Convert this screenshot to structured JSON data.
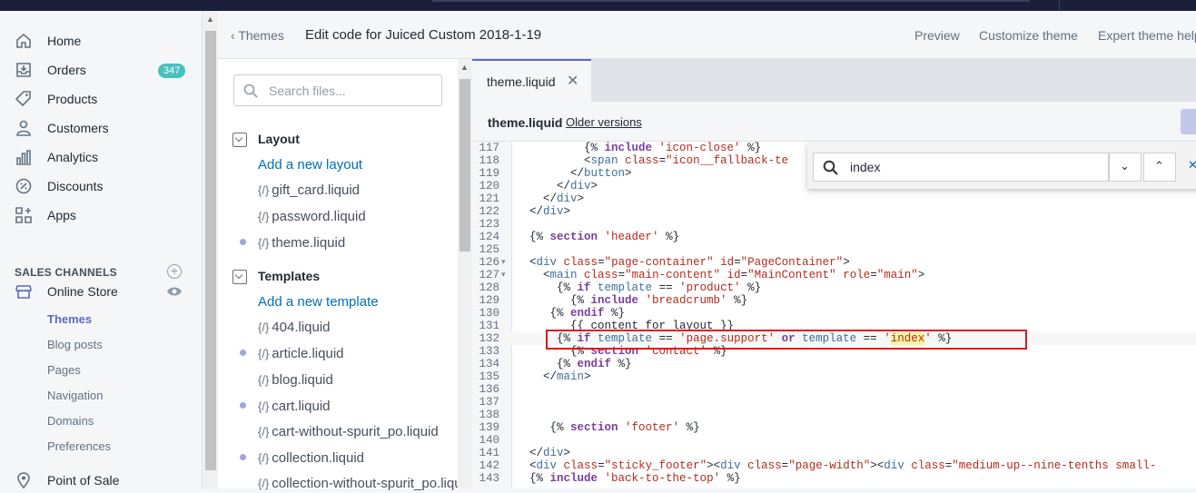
{
  "sidebar": {
    "items": [
      {
        "label": "Home",
        "icon": "home-icon"
      },
      {
        "label": "Orders",
        "icon": "orders-icon",
        "badge": "347"
      },
      {
        "label": "Products",
        "icon": "tag-icon"
      },
      {
        "label": "Customers",
        "icon": "person-icon"
      },
      {
        "label": "Analytics",
        "icon": "bar-chart-icon"
      },
      {
        "label": "Discounts",
        "icon": "discount-icon"
      },
      {
        "label": "Apps",
        "icon": "apps-icon"
      }
    ],
    "channels_heading": "SALES CHANNELS",
    "online_store": "Online Store",
    "sub_items": [
      "Themes",
      "Blog posts",
      "Pages",
      "Navigation",
      "Domains",
      "Preferences"
    ],
    "point_of_sale": "Point of Sale"
  },
  "header": {
    "back_label": "Themes",
    "title_prefix": "Edit code for",
    "theme_name": "Juiced Custom 2018-1-19",
    "actions": [
      "Preview",
      "Customize theme",
      "Expert theme help"
    ]
  },
  "files": {
    "search_placeholder": "Search files...",
    "layout_heading": "Layout",
    "add_layout": "Add a new layout",
    "layout_files": [
      "gift_card.liquid",
      "password.liquid",
      "theme.liquid"
    ],
    "templates_heading": "Templates",
    "add_template": "Add a new template",
    "template_files": [
      "404.liquid",
      "article.liquid",
      "blog.liquid",
      "cart.liquid",
      "cart-without-spurit_po.liquid",
      "collection.liquid",
      "collection-without-spurit_po.liquid"
    ]
  },
  "editor": {
    "tab_name": "theme.liquid",
    "file_name": "theme.liquid",
    "older_versions": "Older versions",
    "find_value": "index",
    "line_numbers": [
      "117",
      "118",
      "119",
      "120",
      "121",
      "122",
      "123",
      "124",
      "125",
      "126",
      "127",
      "128",
      "129",
      "130",
      "131",
      "132",
      "133",
      "134",
      "135",
      "136",
      "137",
      "138",
      "139",
      "140",
      "141",
      "142",
      "143"
    ]
  },
  "colors": {
    "accent": "#5c6ac4",
    "badge": "#47c1bf",
    "highlight_box": "#e0151d",
    "topbar": "#1b1f3b"
  }
}
